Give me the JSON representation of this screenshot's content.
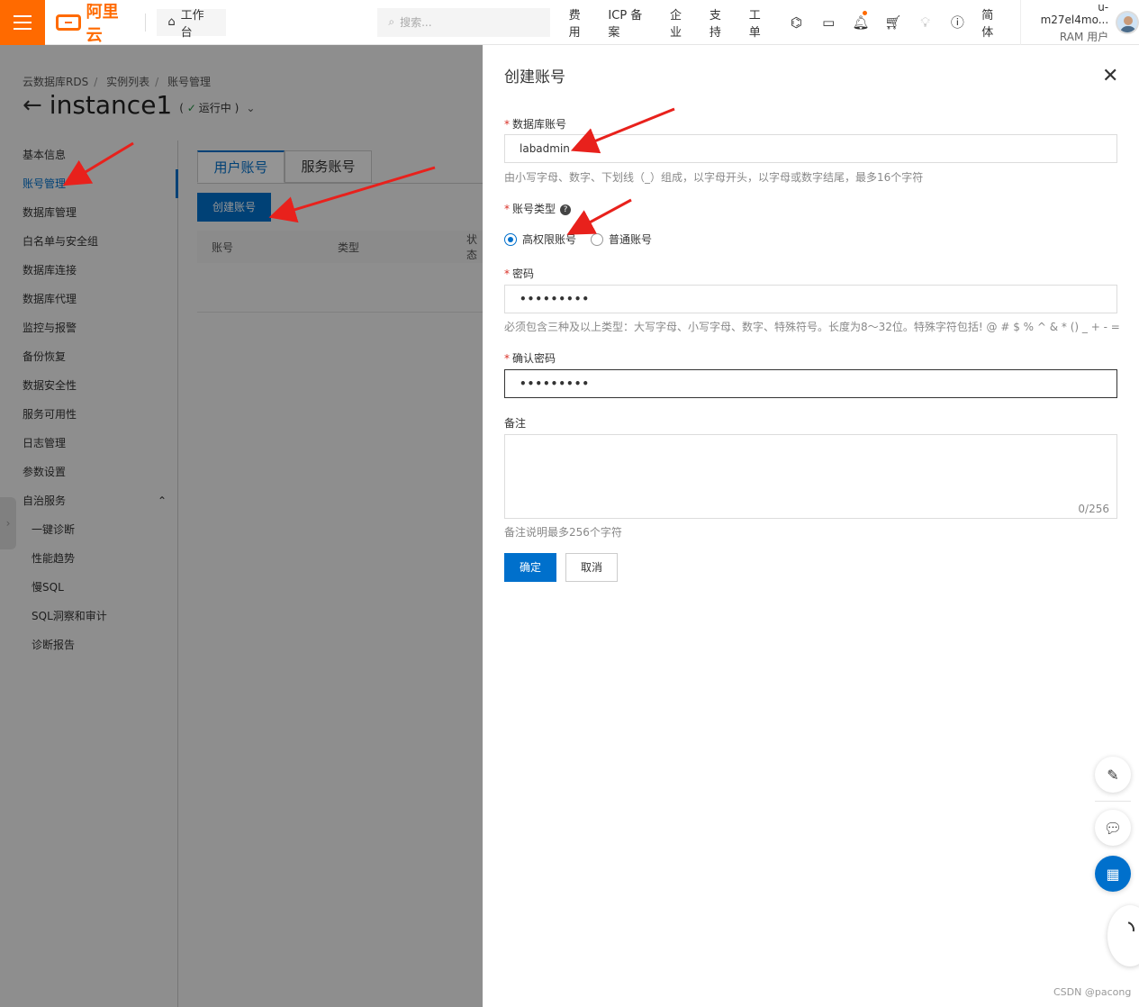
{
  "topbar": {
    "logo_text": "阿里云",
    "workbench_label": "工作台",
    "search_placeholder": "搜索...",
    "nav_items": [
      "费用",
      "ICP 备案",
      "企业",
      "支持",
      "工单"
    ],
    "lang_label": "简体",
    "user_name": "u-m27el4mo...",
    "user_role": "RAM 用户",
    "brand_color": "#ff6a00"
  },
  "page": {
    "breadcrumb": [
      "云数据库RDS",
      "实例列表",
      "账号管理"
    ],
    "instance_title": "instance1",
    "status_text": "运行中",
    "sidenav": {
      "items": [
        "基本信息",
        "账号管理",
        "数据库管理",
        "白名单与安全组",
        "数据库连接",
        "数据库代理",
        "监控与报警",
        "备份恢复",
        "数据安全性",
        "服务可用性",
        "日志管理",
        "参数设置"
      ],
      "group_label": "自治服务",
      "sub_items": [
        "一键诊断",
        "性能趋势",
        "慢SQL",
        "SQL洞察和审计",
        "诊断报告"
      ]
    },
    "tabs": [
      "用户账号",
      "服务账号"
    ],
    "create_button": "创建账号",
    "table_headers": [
      "账号",
      "类型",
      "状态"
    ]
  },
  "drawer": {
    "title": "创建账号",
    "account_label": "数据库账号",
    "account_value": "labadmin",
    "account_hint": "由小写字母、数字、下划线（_）组成，以字母开头，以字母或数字结尾，最多16个字符",
    "type_label": "账号类型",
    "type_options": [
      "高权限账号",
      "普通账号"
    ],
    "type_selected": "高权限账号",
    "password_label": "密码",
    "password_value": "•••••••••",
    "password_hint": "必须包含三种及以上类型：大写字母、小写字母、数字、特殊符号。长度为8～32位。特殊字符包括! @ # $ % ^ & * () _ + - =",
    "confirm_label": "确认密码",
    "confirm_value": "•••••••••",
    "remark_label": "备注",
    "remark_counter": "0/256",
    "remark_hint": "备注说明最多256个字符",
    "ok_button": "确定",
    "cancel_button": "取消"
  },
  "watermark": "CSDN @pacong",
  "accent_color": "#0070cc",
  "annotation_color": "#e8211c"
}
